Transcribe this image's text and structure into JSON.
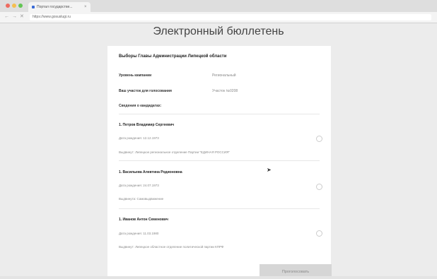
{
  "browser": {
    "tab_title": "Портал государстве...",
    "tab_close": "×",
    "back": "←",
    "forward": "→",
    "reload": "✕",
    "url": "https://www.gosuslugi.ru"
  },
  "page": {
    "title": "Электронный бюллетень"
  },
  "ballot": {
    "election_title": "Выборы Главы Администрации Липецкой области",
    "campaign_level_label": "Уровень кампании",
    "campaign_level_value": "Региональный",
    "precinct_label": "Ваш участок для голосования",
    "precinct_value": "Участок №0208",
    "candidates_header": "Сведения о кандидатах:",
    "candidates": [
      {
        "name": "1. Петров Владимир Сергеевич",
        "birth": "Дата рождения: 12.12.1973",
        "nominated": "Выдвинут: Липецкое региональное отделение Партии \"ЕДИНАЯ РОССИЯ\""
      },
      {
        "name": "1. Васильева Алевтина Родионовна",
        "birth": "Дата рождения: 24.07.1973",
        "nominated": "Выдвинута: Самовыдвижение"
      },
      {
        "name": "1. Иванов Антон Семенович",
        "birth": "Дата рождения: 11.03.1980",
        "nominated": "Выдвинут: Липецкое областное отделение политической партии КПРФ"
      }
    ],
    "submit_label": "Проголосовать"
  }
}
